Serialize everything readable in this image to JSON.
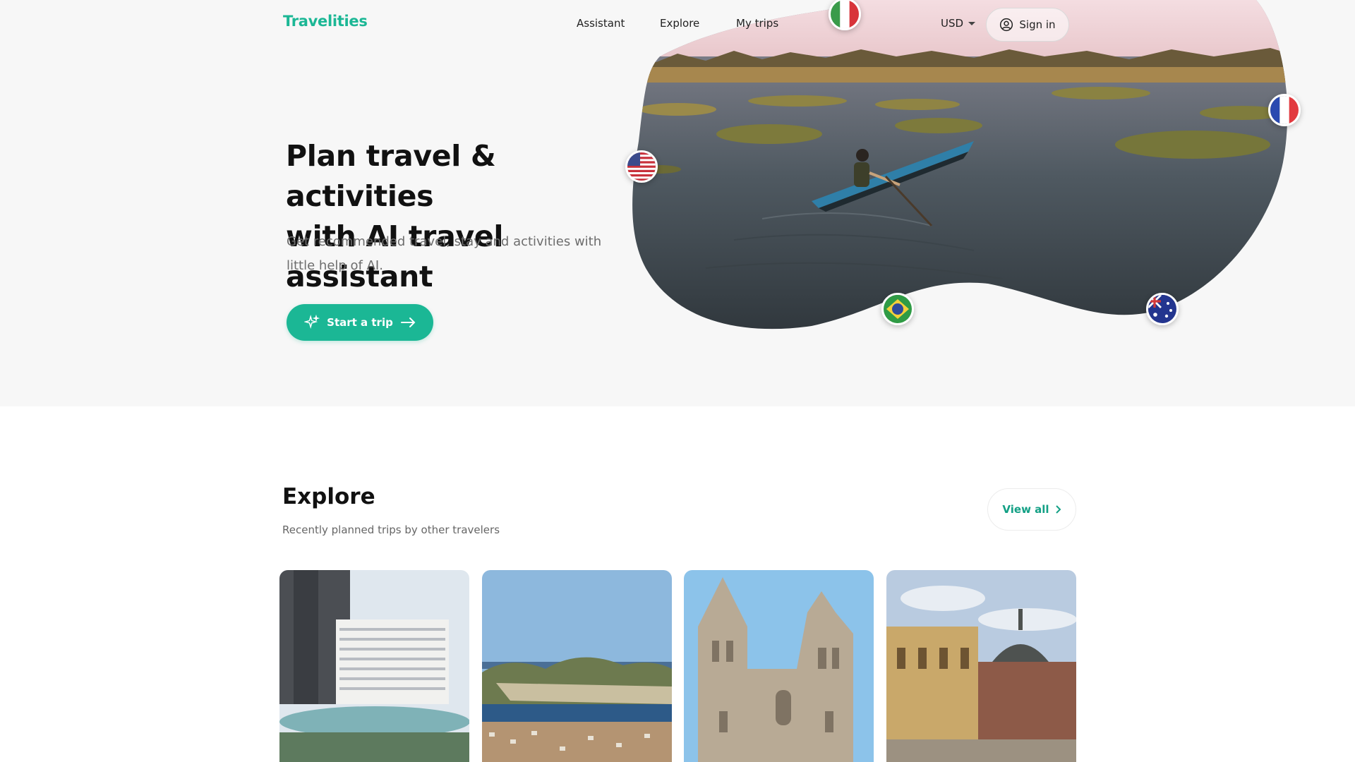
{
  "brand": {
    "name": "Travelities",
    "color": "#1bb795"
  },
  "nav": {
    "items": [
      {
        "label": "Assistant"
      },
      {
        "label": "Explore"
      },
      {
        "label": "My trips"
      }
    ],
    "currency": "USD",
    "signin_label": "Sign in",
    "signin_icon": "user-circle-icon"
  },
  "hero": {
    "title_line1": "Plan travel & activities",
    "title_line2": "with AI travel assistant",
    "subtitle": "Get recommended travel, stay and activities with little help of AI.",
    "cta_label": "Start a trip",
    "cta_icons": [
      "sparkle-icon",
      "arrow-right-icon"
    ],
    "image": "lake-boat-photo",
    "flags": [
      "flag-italy",
      "flag-usa",
      "flag-france",
      "flag-brazil",
      "flag-australia"
    ]
  },
  "explore": {
    "title": "Explore",
    "subtitle": "Recently planned trips by other travelers",
    "view_all_label": "View all",
    "cards": [
      {
        "image": "city-tower-photo"
      },
      {
        "image": "coastal-town-photo"
      },
      {
        "image": "cathedral-photo"
      },
      {
        "image": "historic-square-photo"
      }
    ]
  }
}
